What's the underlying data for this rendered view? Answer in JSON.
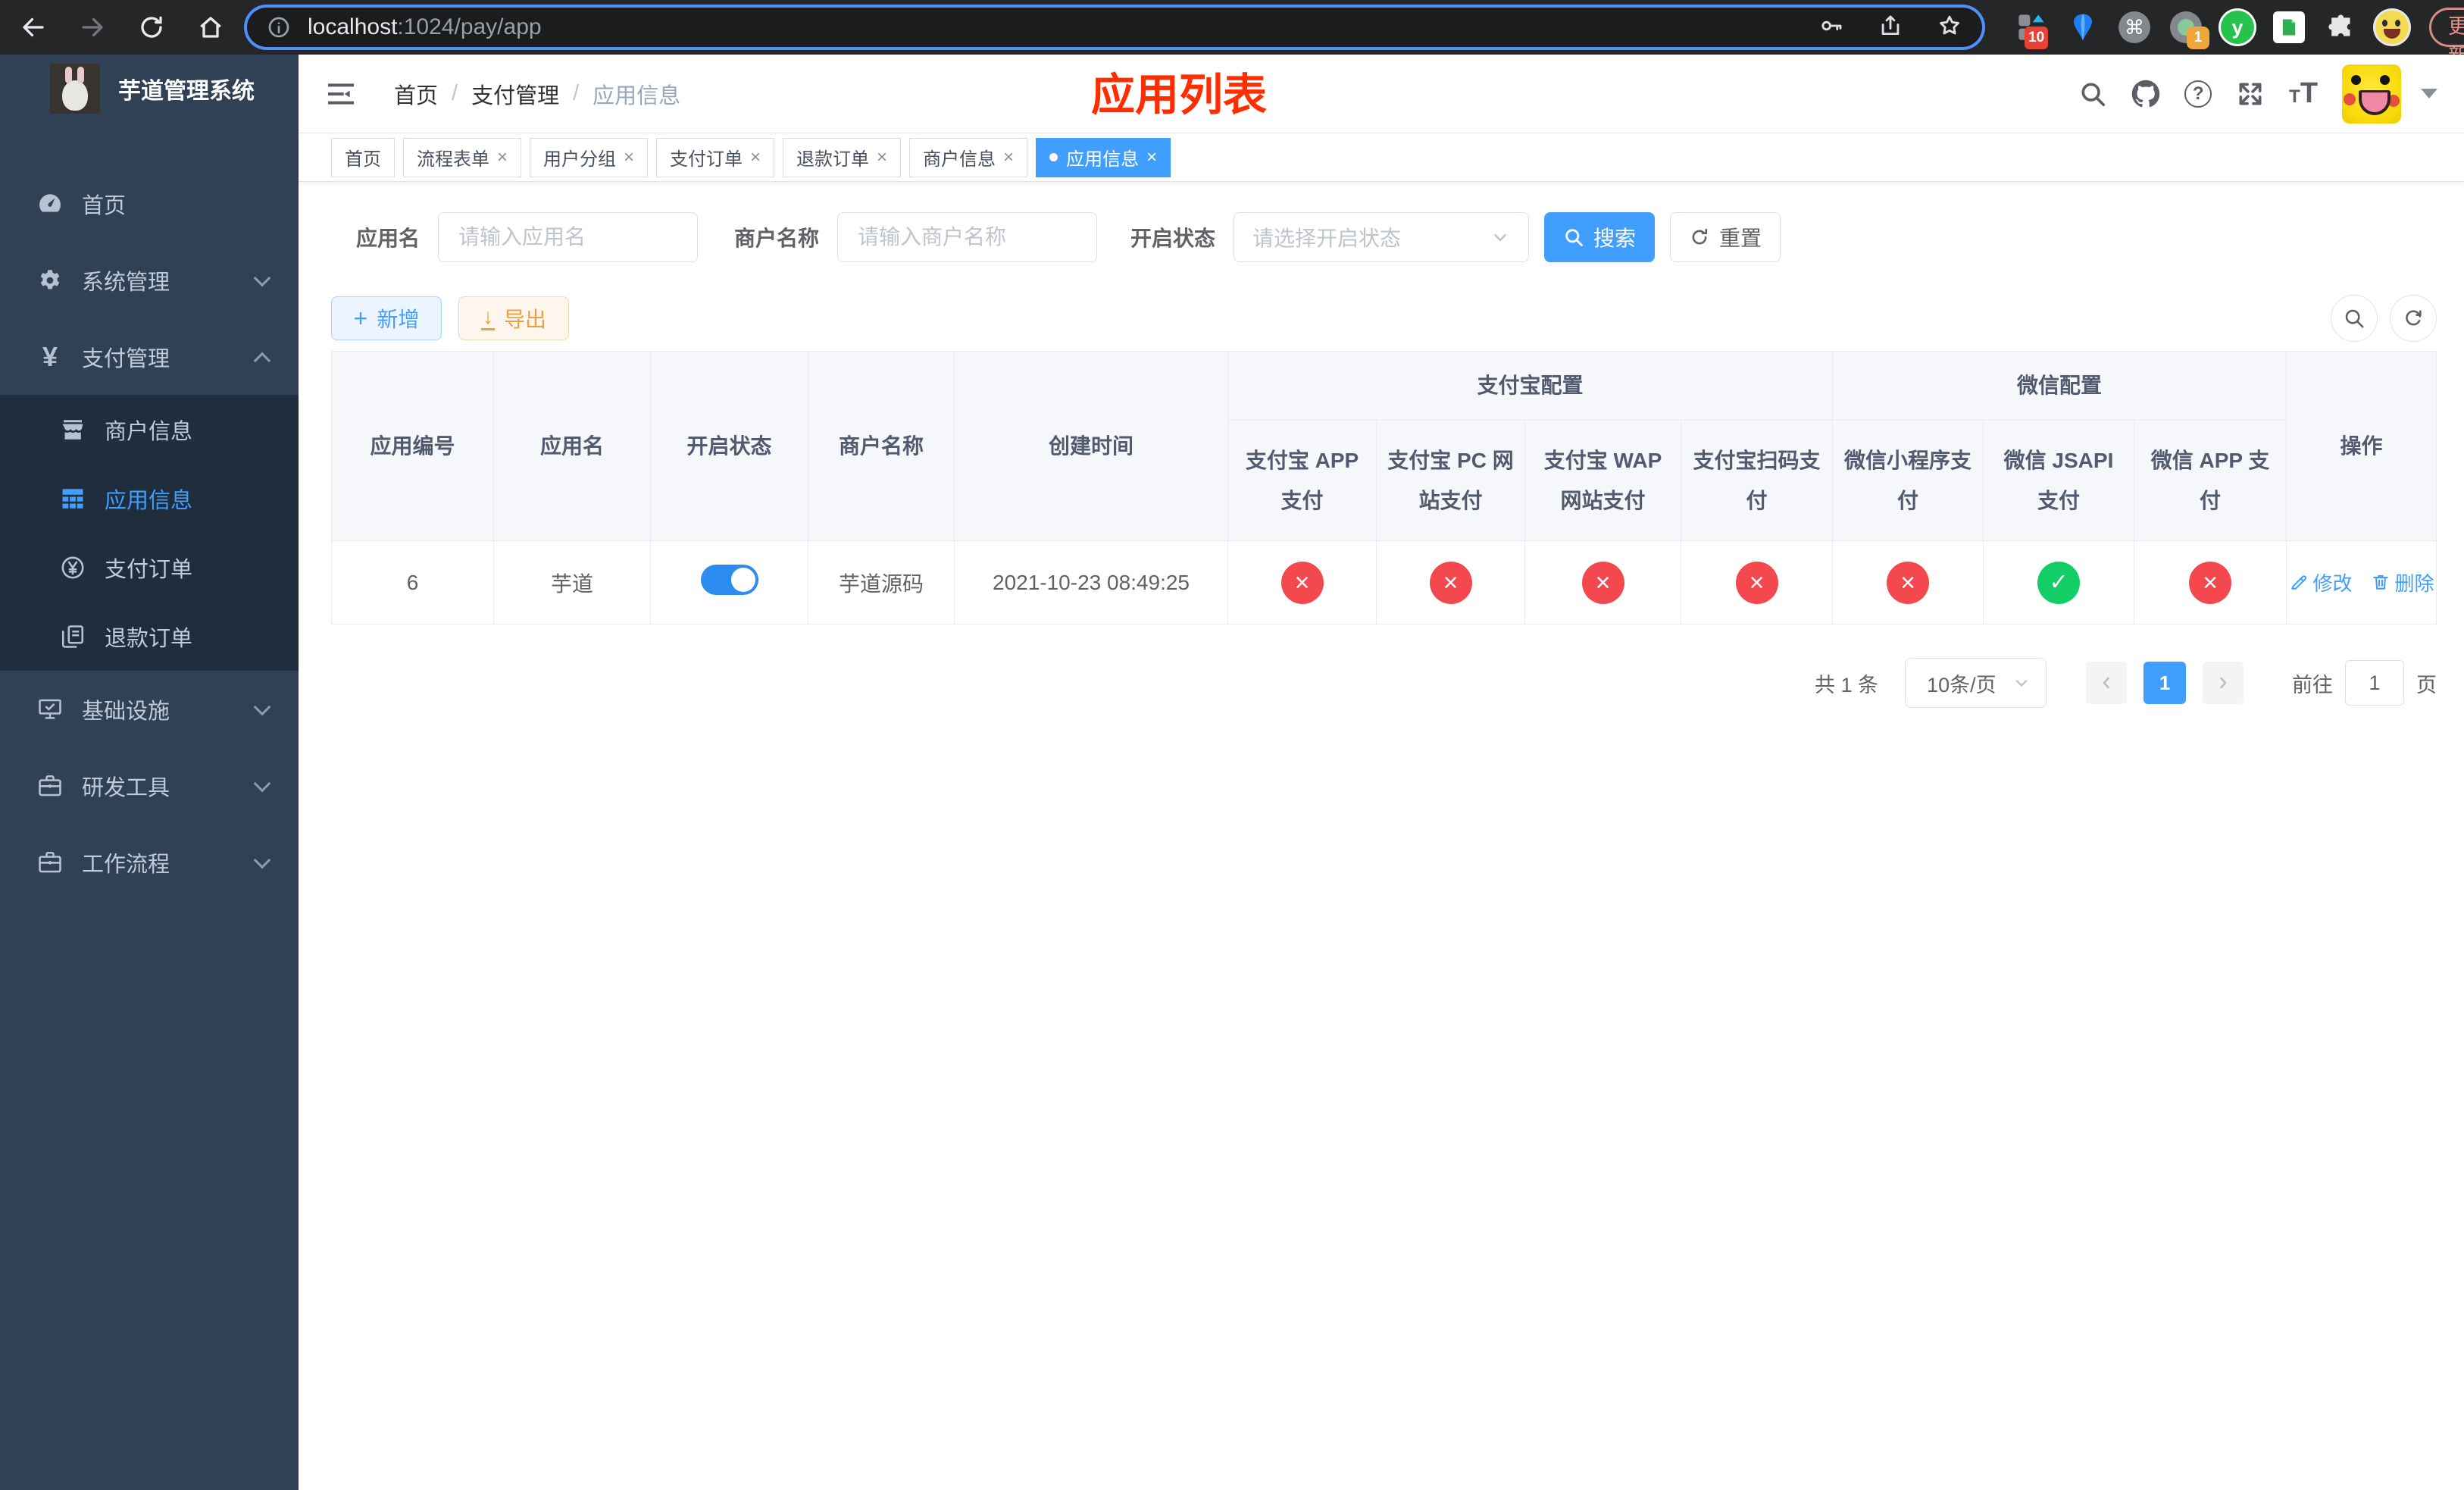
{
  "browser": {
    "host": "localhost",
    "path": ":1024/pay/app",
    "update_label": "更新",
    "ext_badge_1": "10",
    "ext_badge_2": "1",
    "ext_cmd_glyph": "⌘",
    "ext_y_glyph": "y"
  },
  "sidebar": {
    "title": "芋道管理系统",
    "menu": [
      {
        "key": "home",
        "label": "首页",
        "icon": "dashboard-icon",
        "type": "top"
      },
      {
        "key": "system",
        "label": "系统管理",
        "icon": "gear-icon",
        "type": "top",
        "arrow": "down"
      },
      {
        "key": "payment",
        "label": "支付管理",
        "icon": "yen-icon",
        "type": "top",
        "arrow": "up"
      },
      {
        "key": "merchant-info",
        "label": "商户信息",
        "icon": "shop-icon",
        "type": "sub"
      },
      {
        "key": "app-info",
        "label": "应用信息",
        "icon": "grid-icon",
        "type": "sub",
        "active": true
      },
      {
        "key": "pay-order",
        "label": "支付订单",
        "icon": "yen-circle-icon",
        "type": "sub"
      },
      {
        "key": "refund-order",
        "label": "退款订单",
        "icon": "copy-icon",
        "type": "sub"
      },
      {
        "key": "infra",
        "label": "基础设施",
        "icon": "monitor-icon",
        "type": "top",
        "arrow": "down"
      },
      {
        "key": "dev-tools",
        "label": "研发工具",
        "icon": "toolbox-icon",
        "type": "top",
        "arrow": "down"
      },
      {
        "key": "workflow",
        "label": "工作流程",
        "icon": "toolbox-icon",
        "type": "top",
        "arrow": "down"
      }
    ]
  },
  "header": {
    "breadcrumb": [
      {
        "label": "首页"
      },
      {
        "label": "支付管理"
      },
      {
        "label": "应用信息"
      }
    ],
    "breadcrumb_separator": "/",
    "annotation": "应用列表"
  },
  "tabs": [
    {
      "key": "home",
      "label": "首页"
    },
    {
      "key": "process-form",
      "label": "流程表单",
      "closable": true
    },
    {
      "key": "user-group",
      "label": "用户分组",
      "closable": true
    },
    {
      "key": "pay-order",
      "label": "支付订单",
      "closable": true
    },
    {
      "key": "refund-order",
      "label": "退款订单",
      "closable": true
    },
    {
      "key": "merchant-info",
      "label": "商户信息",
      "closable": true
    },
    {
      "key": "app-info",
      "label": "应用信息",
      "closable": true,
      "active": true
    }
  ],
  "filters": {
    "app_name": {
      "label": "应用名",
      "placeholder": "请输入应用名"
    },
    "merchant": {
      "label": "商户名称",
      "placeholder": "请输入商户名称"
    },
    "status": {
      "label": "开启状态",
      "placeholder": "请选择开启状态"
    },
    "search_label": "搜索",
    "reset_label": "重置"
  },
  "toolbar": {
    "add_label": "新增",
    "export_label": "导出"
  },
  "table": {
    "plain_columns": [
      "应用编号",
      "应用名",
      "开启状态",
      "商户名称",
      "创建时间"
    ],
    "groups": [
      {
        "label": "支付宝配置",
        "children": [
          "支付宝 APP 支付",
          "支付宝 PC 网站支付",
          "支付宝 WAP 网站支付",
          "支付宝扫码支付"
        ]
      },
      {
        "label": "微信配置",
        "children": [
          "微信小程序支付",
          "微信 JSAPI 支付",
          "微信 APP 支付"
        ]
      }
    ],
    "action_column": "操作",
    "rows": [
      {
        "app_id": "6",
        "app_name": "芋道",
        "enabled": true,
        "merchant_name": "芋道源码",
        "created_at": "2021-10-23 08:49:25",
        "channel_status": [
          false,
          false,
          false,
          false,
          false,
          true,
          false
        ],
        "edit_label": "修改",
        "delete_label": "删除"
      }
    ]
  },
  "pagination": {
    "total_text": "共 1 条",
    "page_size_text": "10条/页",
    "current_page": "1",
    "goto_label": "前往",
    "goto_value": "1",
    "unit_label": "页"
  },
  "colors": {
    "accent": "#409eff",
    "sidebar_bg": "#304156",
    "submenu_bg": "#1f2d3d",
    "sidebar_text": "#bfcbd9",
    "annotation_red": "#ff2d02",
    "success_green": "#13ce66",
    "danger_red": "#f3494e",
    "warning_orange": "#e6a23c",
    "toggle_on": "#2d8cf0",
    "tab_border": "#d8dce5"
  }
}
